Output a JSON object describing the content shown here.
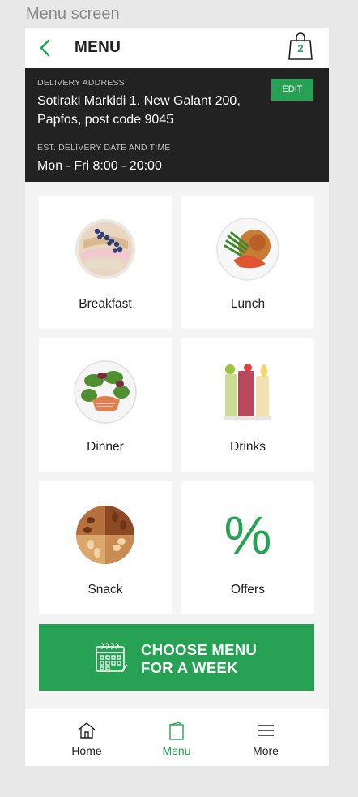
{
  "screen_label": "Menu screen",
  "header": {
    "title": "MENU",
    "cart_count": "2"
  },
  "delivery": {
    "address_label": "DELIVERY ADDRESS",
    "address_line1": "Sotiraki Markidi 1, New Galant 200,",
    "address_line2": "Papfos, post code 9045",
    "time_label": "EST. DELIVERY DATE AND TIME",
    "time_value": "Mon - Fri 8:00 - 20:00",
    "edit_label": "EDIT"
  },
  "categories": [
    {
      "label": "Breakfast",
      "icon": "breakfast-bowl-image"
    },
    {
      "label": "Lunch",
      "icon": "lunch-plate-image"
    },
    {
      "label": "Dinner",
      "icon": "dinner-salad-image"
    },
    {
      "label": "Drinks",
      "icon": "drinks-image"
    },
    {
      "label": "Snack",
      "icon": "nuts-image"
    },
    {
      "label": "Offers",
      "icon": "percent-icon",
      "symbol": "%"
    }
  ],
  "week_button": {
    "line1": "CHOOSE MENU",
    "line2": "FOR A WEEK"
  },
  "nav": [
    {
      "label": "Home",
      "icon": "home-icon"
    },
    {
      "label": "Menu",
      "icon": "menu-bag-icon",
      "active": true
    },
    {
      "label": "More",
      "icon": "hamburger-icon"
    }
  ],
  "colors": {
    "accent": "#27a154",
    "dark_panel": "#222222",
    "background": "#f4f4f4"
  }
}
